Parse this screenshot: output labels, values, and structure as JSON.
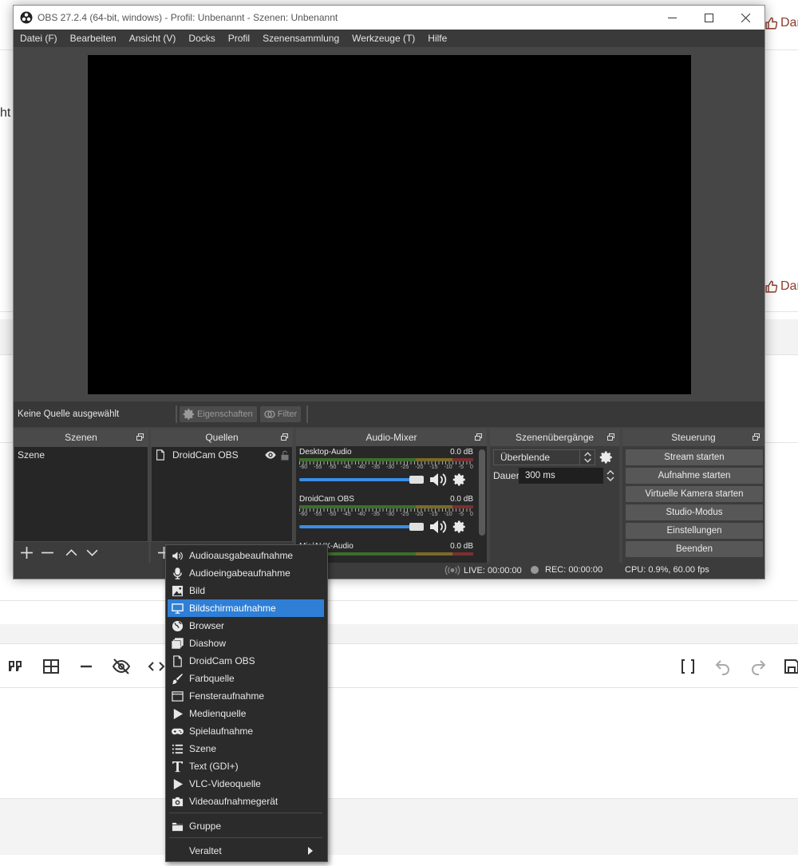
{
  "background": {
    "cut_text_1": "ht",
    "like_label": "Dar",
    "like_label_2": "Dar"
  },
  "window": {
    "title": "OBS 27.2.4 (64-bit, windows) - Profil: Unbenannt - Szenen: Unbenannt"
  },
  "menu": {
    "items": [
      "Datei (F)",
      "Bearbeiten",
      "Ansicht (V)",
      "Docks",
      "Profil",
      "Szenensammlung",
      "Werkzeuge (T)",
      "Hilfe"
    ]
  },
  "sourcebar": {
    "status": "Keine Quelle ausgewählt",
    "properties": "Eigenschaften",
    "filters": "Filter"
  },
  "scenes": {
    "title": "Szenen",
    "items": [
      "Szene"
    ]
  },
  "sources": {
    "title": "Quellen",
    "items": [
      "DroidCam OBS"
    ]
  },
  "mixer": {
    "title": "Audio-Mixer",
    "scale": [
      "-60",
      "-55",
      "-50",
      "-45",
      "-40",
      "-35",
      "-30",
      "-25",
      "-20",
      "-15",
      "-10",
      "-5",
      "0"
    ],
    "channels": [
      {
        "name": "Desktop-Audio",
        "db": "0.0 dB"
      },
      {
        "name": "DroidCam OBS",
        "db": "0.0 dB"
      },
      {
        "name": "Mic/AUX-Audio",
        "db": "0.0 dB"
      }
    ]
  },
  "transitions": {
    "title": "Szenenübergänge",
    "selected": "Überblende",
    "duration_label": "Dauer",
    "duration_value": "300 ms"
  },
  "controls": {
    "title": "Steuerung",
    "buttons": [
      "Stream starten",
      "Aufnahme starten",
      "Virtuelle Kamera starten",
      "Studio-Modus",
      "Einstellungen",
      "Beenden"
    ]
  },
  "status": {
    "live": "LIVE: 00:00:00",
    "rec": "REC: 00:00:00",
    "cpu": "CPU: 0.9%, 60.00 fps"
  },
  "context_menu": {
    "items": [
      {
        "label": "Audioausgabeaufnahme",
        "icon": "speaker-icon"
      },
      {
        "label": "Audioeingabeaufnahme",
        "icon": "microphone-icon"
      },
      {
        "label": "Bild",
        "icon": "image-icon"
      },
      {
        "label": "Bildschirmaufnahme",
        "icon": "monitor-icon",
        "active": true
      },
      {
        "label": "Browser",
        "icon": "globe-icon"
      },
      {
        "label": "Diashow",
        "icon": "slideshow-icon"
      },
      {
        "label": "DroidCam OBS",
        "icon": "file-icon"
      },
      {
        "label": "Farbquelle",
        "icon": "brush-icon"
      },
      {
        "label": "Fensteraufnahme",
        "icon": "window-icon"
      },
      {
        "label": "Medienquelle",
        "icon": "play-icon"
      },
      {
        "label": "Spielaufnahme",
        "icon": "gamepad-icon"
      },
      {
        "label": "Szene",
        "icon": "list-icon"
      },
      {
        "label": "Text (GDI+)",
        "icon": "text-icon"
      },
      {
        "label": "VLC-Videoquelle",
        "icon": "play-icon"
      },
      {
        "label": "Videoaufnahmegerät",
        "icon": "camera-icon"
      }
    ],
    "group": "Gruppe",
    "deprecated": "Veraltet"
  }
}
